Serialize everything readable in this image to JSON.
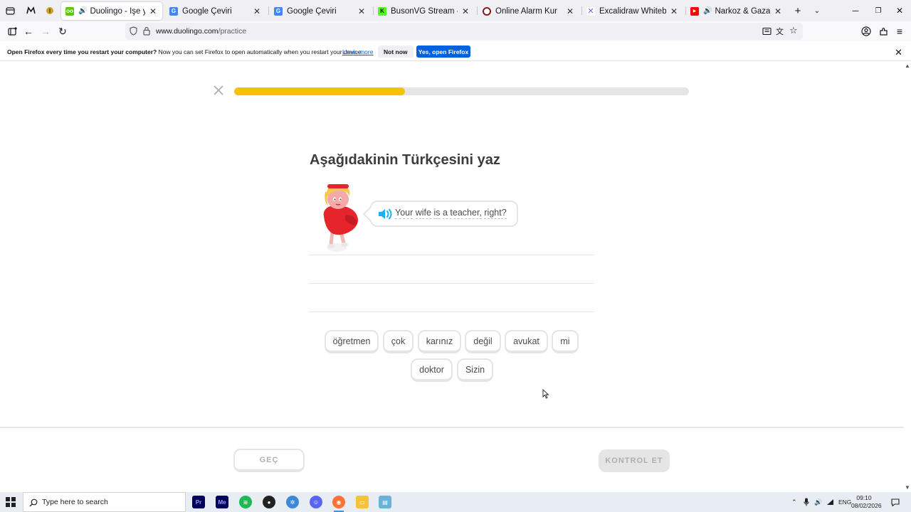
{
  "browser": {
    "tabs": [
      {
        "title": "Duolingo - İşe yarayan de",
        "active": true,
        "audio": true,
        "favicon_color": "#58cc02"
      },
      {
        "title": "Google Çeviri",
        "active": false,
        "favicon_color": "#4285f4"
      },
      {
        "title": "Google Çeviri",
        "active": false,
        "favicon_color": "#4285f4"
      },
      {
        "title": "BusonVG Stream - Watch Live",
        "active": false,
        "favicon_color": "#53fc18"
      },
      {
        "title": "Online Alarm Kur",
        "active": false,
        "favicon_color": "#8b1a1a"
      },
      {
        "title": "Excalidraw Whiteboard",
        "active": false,
        "favicon_color": "#6965db"
      },
      {
        "title": "Narkoz & Gazapizm & Ça",
        "active": false,
        "audio": true,
        "favicon_color": "#ff0000"
      }
    ],
    "url_host": "www.duolingo.com",
    "url_path": "/practice",
    "notification": {
      "bold": "Open Firefox every time you restart your computer?",
      "text": " Now you can set Firefox to open automatically when you restart your device.",
      "link": "Learn more",
      "not_now": "Not now",
      "yes": "Yes, open Firefox"
    }
  },
  "lesson": {
    "progress": 0.375,
    "progress_color": "#f7c300",
    "heading": "Aşağıdakinin Türkçesini yaz",
    "prompt_words": [
      "Your",
      "wife",
      "is",
      "a",
      "teacher,",
      "right?"
    ],
    "word_bank_row1": [
      "öğretmen",
      "çok",
      "karınız",
      "değil",
      "avukat",
      "mi"
    ],
    "word_bank_row2": [
      "doktor",
      "Sizin"
    ],
    "skip_label": "GEÇ",
    "check_label": "KONTROL ET"
  },
  "taskbar": {
    "search_placeholder": "Type here to search",
    "language": "ENG",
    "time": "09:10",
    "date": "08/02/2026"
  }
}
